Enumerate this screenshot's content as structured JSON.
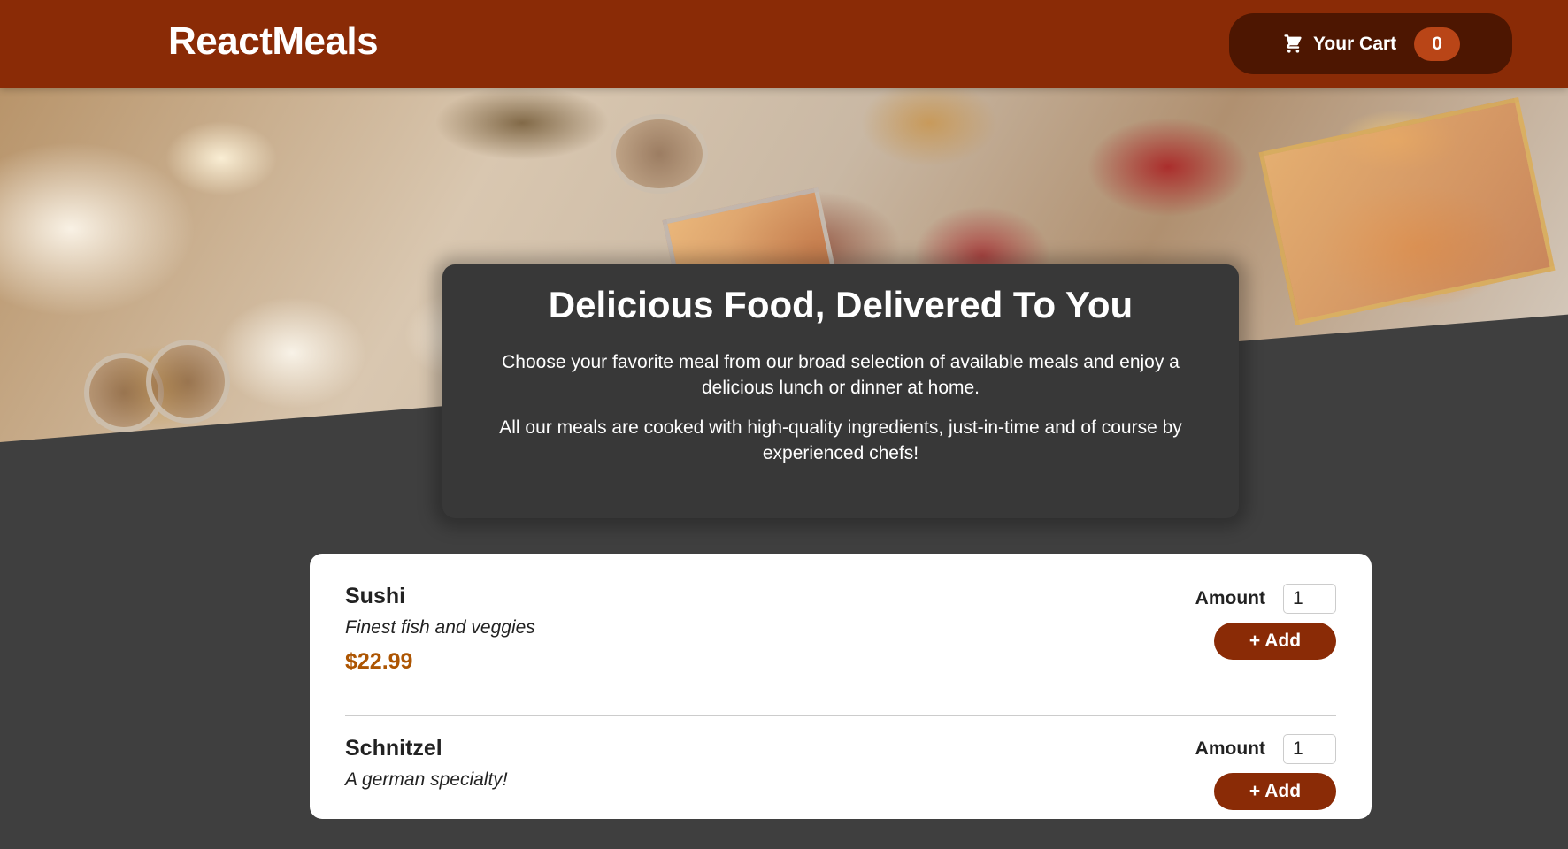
{
  "header": {
    "brand": "ReactMeals",
    "cart_label": "Your Cart",
    "cart_count": "0",
    "cart_icon": "cart-icon"
  },
  "summary": {
    "title": "Delicious Food, Delivered To You",
    "paragraph1": "Choose your favorite meal from our broad selection of available meals and enjoy a delicious lunch or dinner at home.",
    "paragraph2": "All our meals are cooked with high-quality ingredients, just-in-time and of course by experienced chefs!"
  },
  "meals": [
    {
      "name": "Sushi",
      "description": "Finest fish and veggies",
      "price": "$22.99",
      "amount_label": "Amount",
      "amount_value": "1",
      "add_label": "+ Add"
    },
    {
      "name": "Schnitzel",
      "description": "A german specialty!",
      "amount_label": "Amount",
      "amount_value": "1",
      "add_label": "+ Add"
    }
  ],
  "colors": {
    "header_bg": "#8a2b06",
    "cart_bg": "#4d1601",
    "badge_bg": "#b94517",
    "page_bg": "#3f3f3f",
    "summary_bg": "#383838",
    "price": "#ad5502"
  }
}
